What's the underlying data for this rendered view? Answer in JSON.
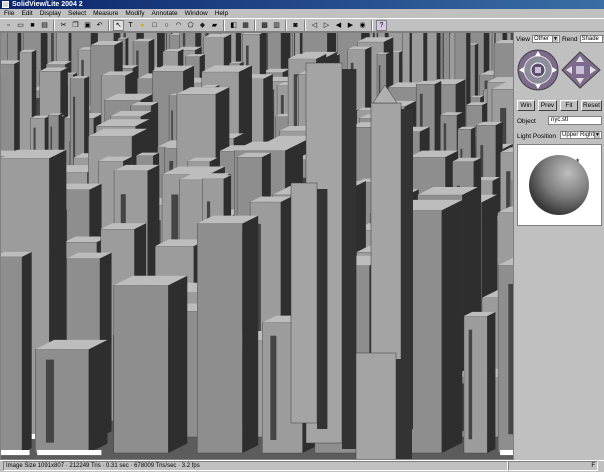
{
  "app": {
    "title": "SolidView/Lite 2004 2"
  },
  "menu": [
    "File",
    "Edit",
    "Display",
    "Select",
    "Measure",
    "Modify",
    "Annotate",
    "Window",
    "Help"
  ],
  "toolbar_icons": [
    "new-icon",
    "open-icon",
    "save-icon",
    "print-icon",
    "sep",
    "cut-icon",
    "copy-icon",
    "paste-icon",
    "undo-icon",
    "sep",
    "select-arrow-icon",
    "text-icon",
    "point-icon",
    "rectangle-icon",
    "circle-icon",
    "arc-icon",
    "polygon-icon",
    "fill-icon",
    "eraser-icon",
    "sep",
    "measure-icon",
    "grid-icon",
    "sep",
    "capture-icon",
    "save-view-icon",
    "sep",
    "camera-icon",
    "sep",
    "step-back-icon",
    "step-forward-icon",
    "play-back-icon",
    "play-forward-icon",
    "record-icon",
    "sep",
    "help-icon"
  ],
  "panel": {
    "view_label": "View",
    "view_value": "Other",
    "rend_label": "Rend",
    "rend_value": "Shade",
    "buttons": [
      "Win",
      "Prev",
      "Fit",
      "Reset"
    ],
    "object_label": "Object",
    "object_value": "nyc.stl",
    "light_label": "Light Position",
    "light_value": "Upper Right"
  },
  "status": {
    "image_size": "Image Size 1091x807 · 212249 Tris · 0.31 sec · 678009 Tris/sec · 3.2 fps",
    "indicator": "F"
  },
  "colors": {
    "title_start": "#0a246a",
    "title_end": "#3a6ea5",
    "panel": "#c0c0c0",
    "compass_purple": "#7d6a8c",
    "building_face": "#9a9a9a",
    "building_dark": "#3a3a3a"
  }
}
